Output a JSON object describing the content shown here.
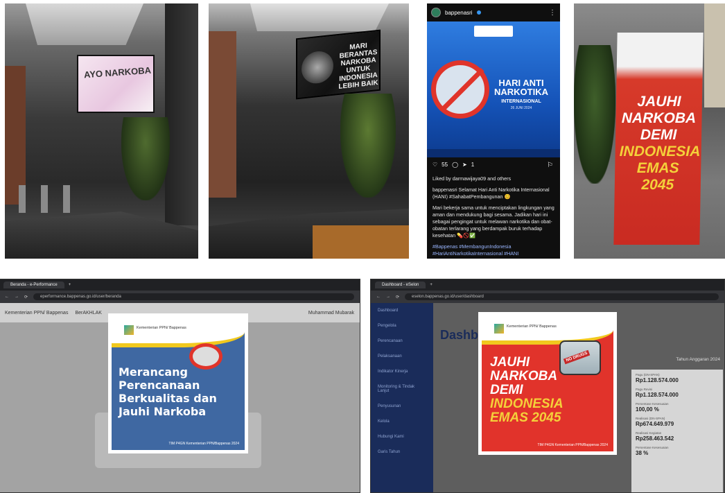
{
  "photo1": {
    "screen_text": "AYO NARKOBA"
  },
  "photo2": {
    "screen_text": "MARI BERANTAS NARKOBA UNTUK INDONESIA LEBIH BAIK"
  },
  "instagram": {
    "account": "bappenasri",
    "post_title": "HARI ANTI NARKOTIKA",
    "post_subtitle": "INTERNASIONAL",
    "post_date": "26 JUNI 2024",
    "likes": "55",
    "shares": "1",
    "liked_by": "Liked by darmawijaya09 and others",
    "caption1": "bappenasri Selamat Hari Anti Narkotika Internasional (HANI) #SahabatPembangunan 😊",
    "caption2": "Mari bekerja sama untuk menciptakan lingkungan yang aman dan mendukung bagi sesama. Jadikan hari ini sebagai pengingat untuk melawan narkotika dan obat-obatan terlarang yang berdampak buruk terhadap kesehatan 💊🚫✅",
    "hashtags": "#Bappenas #MembangunIndonesia #HariAntiNarkotikaInternasional #HANI"
  },
  "banner": {
    "line1": "JAUHI",
    "line2": "NARKOBA",
    "line3": "DEMI",
    "line4": "INDONESIA",
    "line5": "EMAS 2045"
  },
  "window1": {
    "tab": "Beranda - e-Performance",
    "url": "eperformance.bappenas.go.id/user/beranda",
    "brand": "Kementerian PPN/ Bappenas",
    "brand2": "BerAKHLAK",
    "user": "Muhammad Mubarak"
  },
  "poster1": {
    "org": "Kementerian PPN/ Bappenas",
    "headline": "Merancang Perencanaan Berkualitas dan Jauhi Narkoba",
    "footer": "TIM P4GN Kementerian PPN/Bappenas 2024"
  },
  "window2": {
    "tab": "Dashboard - eSelon",
    "url": "eselon.bappenas.go.id/user/dashboard",
    "title": "Dashbo",
    "fiscal_year": "Tahun Anggaran 2024",
    "side_items": [
      "Dashboard",
      "Pengelola",
      "Perencanaan",
      "Pelaksanaan",
      "Indikator Kinerja",
      "Monitoring & Tindak Lanjut",
      "Penyusunan",
      "Kelola",
      "Hubungi Kami",
      "Garis Tahun"
    ],
    "stats": [
      {
        "label": "Pagu (DN-SPAN)",
        "value": "Rp1.128.574.000"
      },
      {
        "label": "Pagu Revisi",
        "value": "Rp1.128.574.000"
      },
      {
        "label": "Persentase Kesesuaian",
        "value": "100,00 %"
      },
      {
        "label": "Realisasi (DN-SPAN)",
        "value": "Rp674.649.979"
      },
      {
        "label": "Realisasi Kegiatan",
        "value": "Rp258.463.542"
      },
      {
        "label": "Persentase Kesesuaian",
        "value": "38 %"
      }
    ],
    "status_url": "https://eselon.bappenas.go.id/user/dashboard"
  },
  "poster2": {
    "org": "Kementerian PPN/ Bappenas",
    "line1": "JAUHI",
    "line2": "NARKOBA",
    "line3": "DEMI",
    "line4": "INDONESIA",
    "line5": "EMAS 2045",
    "badge": "NO DRUGS",
    "footer": "TIM P4GN Kementerian PPN/Bappenas 2024"
  }
}
